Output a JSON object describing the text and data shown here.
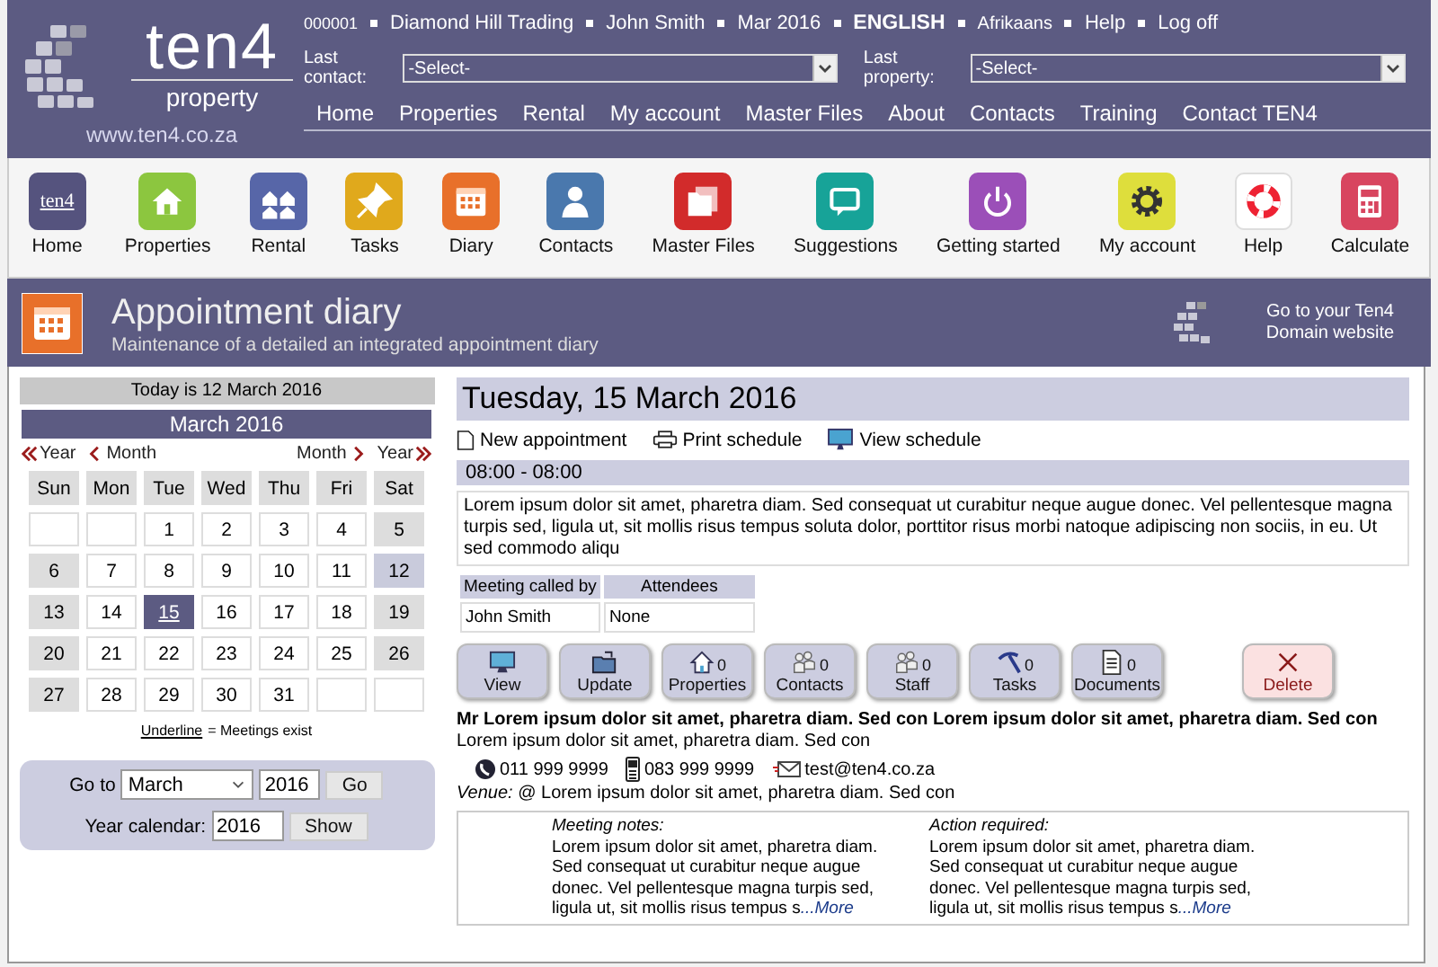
{
  "header": {
    "logo": {
      "name": "ten4",
      "tagline": "property",
      "url": "www.ten4.co.za"
    },
    "info": [
      "000001",
      "Diamond Hill Trading",
      "John Smith",
      "Mar 2016"
    ],
    "languages": [
      {
        "label": "ENGLISH",
        "selected": true
      },
      {
        "label": "Afrikaans",
        "selected": false
      }
    ],
    "links": [
      "Help",
      "Log off"
    ],
    "selectors": [
      {
        "label": "Last contact:",
        "value": "-Select-"
      },
      {
        "label": "Last property:",
        "value": "-Select-"
      }
    ],
    "nav": [
      "Home",
      "Properties",
      "Rental",
      "My account",
      "Master Files",
      "About",
      "Contacts",
      "Training",
      "Contact TEN4"
    ]
  },
  "toolbar": [
    {
      "label": "Home",
      "color": "#55537e",
      "glyph": "ten4"
    },
    {
      "label": "Properties",
      "color": "#8cc63f"
    },
    {
      "label": "Rental",
      "color": "#5766a8"
    },
    {
      "label": "Tasks",
      "color": "#e0a91c"
    },
    {
      "label": "Diary",
      "color": "#e8702a"
    },
    {
      "label": "Contacts",
      "color": "#4a78ad"
    },
    {
      "label": "Master Files",
      "color": "#d22b2b"
    },
    {
      "label": "Suggestions",
      "color": "#17a398"
    },
    {
      "label": "Getting started",
      "color": "#9b4fb8"
    },
    {
      "label": "My account",
      "color": "#dede3c"
    },
    {
      "label": "Help",
      "color": "#ffffff"
    },
    {
      "label": "Calculate",
      "color": "#d8455f"
    }
  ],
  "page": {
    "title": "Appointment diary",
    "subtitle": "Maintenance of a detailed an integrated appointment diary",
    "domain_link": "Go to your Ten4 Domain website"
  },
  "calendar": {
    "today": "Today is  12 March 2016",
    "month": "March 2016",
    "nav": {
      "prev_year": "Year",
      "prev_month": "Month",
      "next_month": "Month",
      "next_year": "Year"
    },
    "weekdays": [
      "Sun",
      "Mon",
      "Tue",
      "Wed",
      "Thu",
      "Fri",
      "Sat"
    ],
    "weeks": [
      [
        {
          "kind": "blank"
        },
        {
          "kind": "blank"
        },
        {
          "kind": "day",
          "day": "1",
          "selected": false,
          "today": false,
          "meetings": false
        },
        {
          "kind": "day",
          "day": "2",
          "selected": false,
          "today": false,
          "meetings": false
        },
        {
          "kind": "day",
          "day": "3",
          "selected": false,
          "today": false,
          "meetings": false
        },
        {
          "kind": "day",
          "day": "4",
          "selected": false,
          "today": false,
          "meetings": false
        },
        {
          "kind": "day",
          "day": "5",
          "selected": false,
          "today": false,
          "meetings": false
        }
      ],
      [
        {
          "kind": "day",
          "day": "6",
          "selected": false,
          "today": false,
          "meetings": false
        },
        {
          "kind": "day",
          "day": "7",
          "selected": false,
          "today": false,
          "meetings": false
        },
        {
          "kind": "day",
          "day": "8",
          "selected": false,
          "today": false,
          "meetings": false
        },
        {
          "kind": "day",
          "day": "9",
          "selected": false,
          "today": false,
          "meetings": false
        },
        {
          "kind": "day",
          "day": "10",
          "selected": false,
          "today": false,
          "meetings": false
        },
        {
          "kind": "day",
          "day": "11",
          "selected": false,
          "today": false,
          "meetings": false
        },
        {
          "kind": "day",
          "day": "12",
          "selected": false,
          "today": true,
          "meetings": false
        }
      ],
      [
        {
          "kind": "day",
          "day": "13",
          "selected": false,
          "today": false,
          "meetings": false
        },
        {
          "kind": "day",
          "day": "14",
          "selected": false,
          "today": false,
          "meetings": false
        },
        {
          "kind": "day",
          "day": "15",
          "selected": true,
          "today": false,
          "meetings": true
        },
        {
          "kind": "day",
          "day": "16",
          "selected": false,
          "today": false,
          "meetings": false
        },
        {
          "kind": "day",
          "day": "17",
          "selected": false,
          "today": false,
          "meetings": false
        },
        {
          "kind": "day",
          "day": "18",
          "selected": false,
          "today": false,
          "meetings": false
        },
        {
          "kind": "day",
          "day": "19",
          "selected": false,
          "today": false,
          "meetings": false
        }
      ],
      [
        {
          "kind": "day",
          "day": "20",
          "selected": false,
          "today": false,
          "meetings": false
        },
        {
          "kind": "day",
          "day": "21",
          "selected": false,
          "today": false,
          "meetings": false
        },
        {
          "kind": "day",
          "day": "22",
          "selected": false,
          "today": false,
          "meetings": false
        },
        {
          "kind": "day",
          "day": "23",
          "selected": false,
          "today": false,
          "meetings": false
        },
        {
          "kind": "day",
          "day": "24",
          "selected": false,
          "today": false,
          "meetings": false
        },
        {
          "kind": "day",
          "day": "25",
          "selected": false,
          "today": false,
          "meetings": false
        },
        {
          "kind": "day",
          "day": "26",
          "selected": false,
          "today": false,
          "meetings": false
        }
      ],
      [
        {
          "kind": "day",
          "day": "27",
          "selected": false,
          "today": false,
          "meetings": false
        },
        {
          "kind": "day",
          "day": "28",
          "selected": false,
          "today": false,
          "meetings": false
        },
        {
          "kind": "day",
          "day": "29",
          "selected": false,
          "today": false,
          "meetings": false
        },
        {
          "kind": "day",
          "day": "30",
          "selected": false,
          "today": false,
          "meetings": false
        },
        {
          "kind": "day",
          "day": "31",
          "selected": false,
          "today": false,
          "meetings": false
        },
        {
          "kind": "blank"
        },
        {
          "kind": "blank"
        }
      ]
    ],
    "legend": {
      "term": "Underline",
      "text": "= Meetings exist"
    }
  },
  "goto": {
    "label": "Go to",
    "month": "March",
    "year": "2016",
    "button": "Go",
    "year_label": "Year calendar:",
    "year_value": "2016",
    "show_button": "Show"
  },
  "day": {
    "heading": "Tuesday, 15 March 2016",
    "links": [
      "New appointment",
      "Print schedule",
      "View schedule"
    ],
    "time": "08:00 - 08:00",
    "description": "Lorem ipsum dolor sit amet, pharetra diam. Sed consequat ut curabitur neque augue donec. Vel pellentesque magna turpis sed, ligula ut, sit mollis risus tempus soluta dolor, porttitor risus morbi natoque adipiscing non sociis, in eu. Ut sed commodo aliqu",
    "table": {
      "columns": [
        "Meeting called by",
        "Attendees"
      ],
      "row": [
        "John Smith",
        "None"
      ]
    },
    "actions": [
      {
        "label": "View",
        "kind": "normal"
      },
      {
        "label": "Update",
        "kind": "normal"
      },
      {
        "label": "Properties",
        "count": "0",
        "kind": "normal"
      },
      {
        "label": "Contacts",
        "count": "0",
        "kind": "normal"
      },
      {
        "label": "Staff",
        "count": "0",
        "kind": "normal"
      },
      {
        "label": "Tasks",
        "count": "0",
        "kind": "normal"
      },
      {
        "label": "Documents",
        "count": "0",
        "kind": "normal"
      },
      {
        "label": "Delete",
        "kind": "danger"
      }
    ],
    "contact": "**Mr Lorem ipsum dolor sit amet, pharetra diam. Sed con Lorem ipsum dolor sit amet, pharetra diam. Sed con** Lorem ipsum dolor sit amet, pharetra diam. Sed con",
    "phone": "011 999 9999",
    "mobile": "083 999 9999",
    "email": "test@ten4.co.za",
    "venue": "*Venue:* @ Lorem ipsum dolor sit amet, pharetra diam. Sed con",
    "notes": [
      {
        "heading": "Meeting notes:",
        "text": "Lorem ipsum dolor sit amet, pharetra diam. Sed consequat ut curabitur neque augue donec. Vel pellentesque magna turpis sed, ligula ut, sit mollis risus tempus s",
        "more": "...More"
      },
      {
        "heading": "Action required:",
        "text": "Lorem ipsum dolor sit amet, pharetra diam. Sed consequat ut curabitur neque augue donec. Vel pellentesque magna turpis sed, ligula ut, sit mollis risus tempus s",
        "more": "...More"
      }
    ]
  }
}
